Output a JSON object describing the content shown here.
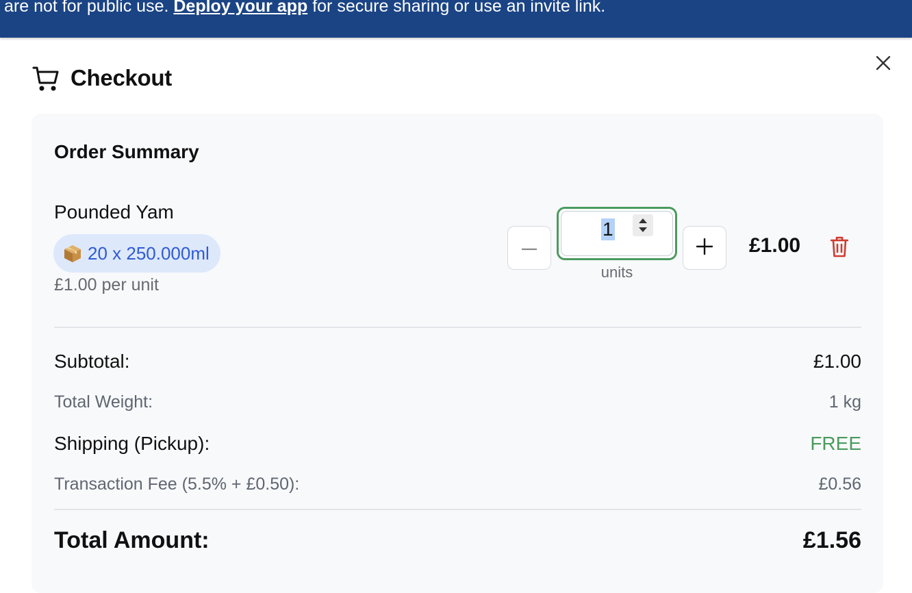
{
  "banner": {
    "text_before": "are not for public use. ",
    "link_text": "Deploy your app",
    "text_after": " for secure sharing or use an invite link."
  },
  "header": {
    "icon": "shopping-cart-icon",
    "title": "Checkout",
    "close_icon": "close-icon"
  },
  "summary": {
    "title": "Order Summary",
    "item": {
      "name": "Pounded Yam",
      "pack_icon": "package-icon",
      "pack_label": "20 x 250.000ml",
      "unit_price": "£1.00 per unit",
      "quantity": "1",
      "quantity_unit": "units",
      "line_total": "£1.00",
      "delete_icon": "trash-icon"
    },
    "rows": {
      "subtotal_label": "Subtotal:",
      "subtotal_value": "£1.00",
      "weight_label": "Total Weight:",
      "weight_value": "1 kg",
      "shipping_label": "Shipping (Pickup):",
      "shipping_value": "FREE",
      "fee_label": "Transaction Fee (5.5% + £0.50):",
      "fee_value": "£0.56",
      "total_label": "Total Amount:",
      "total_value": "£1.56"
    }
  },
  "colors": {
    "banner_bg": "#1b4485",
    "accent_green": "#4a9b5e",
    "badge_bg": "#dde8fb",
    "badge_text": "#2f5bd3",
    "delete_red": "#d03a2f"
  }
}
